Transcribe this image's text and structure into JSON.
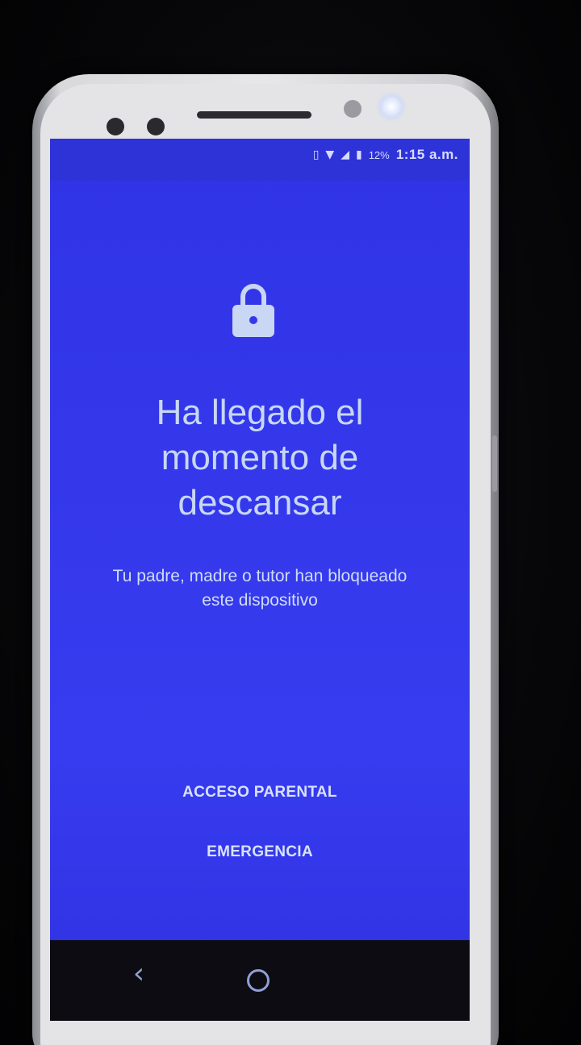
{
  "status_bar": {
    "icons": [
      "vibrate-icon",
      "wifi-icon",
      "signal-icon",
      "battery-icon"
    ],
    "battery_percent": "12%",
    "time": "1:15 a.m."
  },
  "lock_screen": {
    "icon": "lock-icon",
    "title_lines": [
      "Ha llegado el",
      "momento de",
      "descansar"
    ],
    "subtitle_lines": [
      "Tu padre, madre o tutor han bloqueado",
      "este dispositivo"
    ],
    "parental_access_label": "ACCESO PARENTAL",
    "emergency_label": "EMERGENCIA"
  },
  "nav_bar": {
    "back_icon": "back-chevron-icon",
    "home_icon": "home-circle-icon"
  },
  "colors": {
    "screen_background": "#3438ea",
    "text": "#c8d7f6"
  }
}
